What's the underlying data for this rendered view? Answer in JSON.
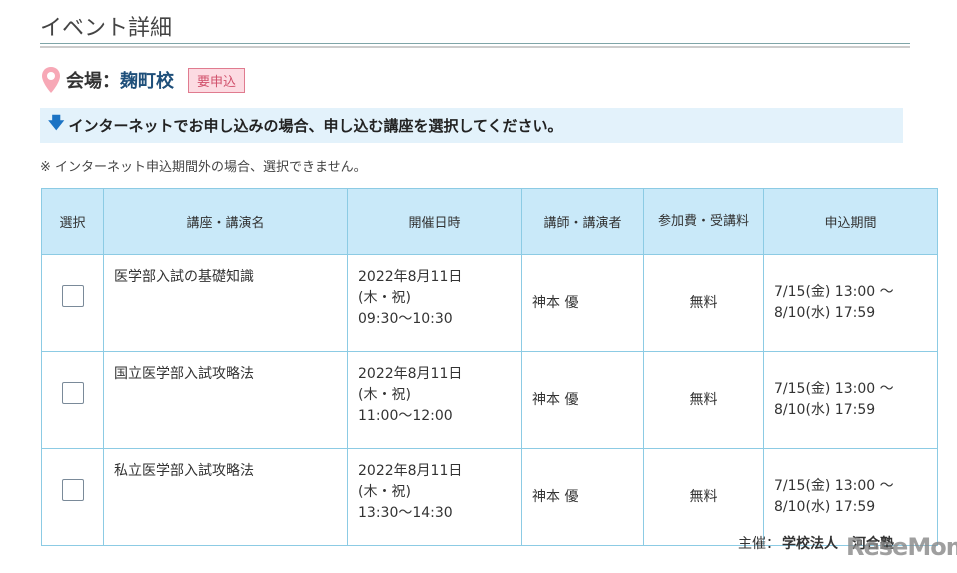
{
  "page_title": "イベント詳細",
  "venue": {
    "label": "会場：",
    "name": "麹町校",
    "badge": "要申込"
  },
  "instruction": "インターネットでお申し込みの場合、申し込む講座を選択してください。",
  "note": "※ インターネット申込期間外の場合、選択できません。",
  "table": {
    "headers": [
      "選択",
      "講座・講演名",
      "開催日時",
      "講師・講演者",
      "参加費・受講料",
      "申込期間"
    ],
    "rows": [
      {
        "name": "医学部入試の基礎知識",
        "date": "2022年8月11日",
        "day": "(木・祝)",
        "time": "09:30～10:30",
        "lecturer": "神本 優",
        "fee": "無料",
        "period_start": "7/15(金) 13:00 ～",
        "period_end": "8/10(水) 17:59"
      },
      {
        "name": "国立医学部入試攻略法",
        "date": "2022年8月11日",
        "day": "(木・祝)",
        "time": "11:00～12:00",
        "lecturer": "神本 優",
        "fee": "無料",
        "period_start": "7/15(金) 13:00 ～",
        "period_end": "8/10(水) 17:59"
      },
      {
        "name": "私立医学部入試攻略法",
        "date": "2022年8月11日",
        "day": "(木・祝)",
        "time": "13:30～14:30",
        "lecturer": "神本 優",
        "fee": "無料",
        "period_start": "7/15(金) 13:00 ～",
        "period_end": "8/10(水) 17:59"
      }
    ]
  },
  "host": {
    "label": "主催：",
    "name": "学校法人　河合塾"
  },
  "watermark": "ReseMom"
}
